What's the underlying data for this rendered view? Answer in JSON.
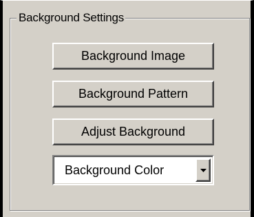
{
  "group": {
    "title": "Background Settings"
  },
  "buttons": {
    "image_label": "Background Image",
    "pattern_label": "Background Pattern",
    "adjust_label": "Adjust Background"
  },
  "dropdown": {
    "selected_value": "Background Color",
    "arrow_icon": "chevron-down-icon"
  }
}
